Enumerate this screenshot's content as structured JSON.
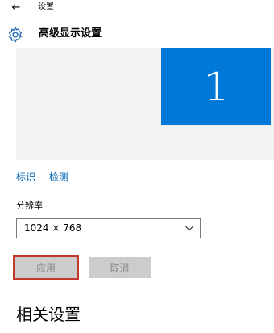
{
  "window": {
    "app_title": "设置"
  },
  "header": {
    "page_title": "高级显示设置"
  },
  "display": {
    "monitor_number": "1"
  },
  "links": {
    "identify": "标识",
    "detect": "检测"
  },
  "resolution": {
    "label": "分辨率",
    "value": "1024 × 768"
  },
  "buttons": {
    "apply": "应用",
    "cancel": "取消"
  },
  "related": {
    "heading": "相关设置"
  },
  "icons": {
    "back": "back-arrow-icon",
    "settings": "gear-icon",
    "dropdown": "chevron-down-icon"
  },
  "colors": {
    "accent": "#0078d7",
    "link": "#0063b1",
    "highlight": "#c0392b"
  }
}
